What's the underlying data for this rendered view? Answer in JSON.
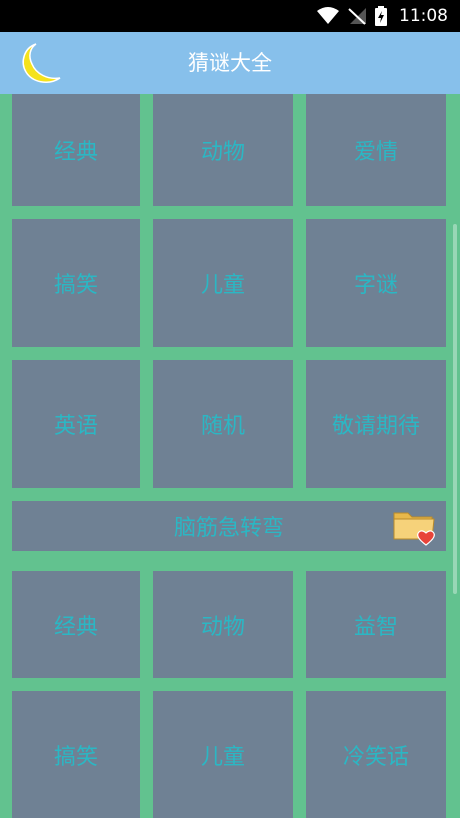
{
  "status_bar": {
    "time": "11:08"
  },
  "app_bar": {
    "title": "猜谜大全"
  },
  "riddle_grid": [
    {
      "label": "经典"
    },
    {
      "label": "动物"
    },
    {
      "label": "爱情"
    },
    {
      "label": "搞笑"
    },
    {
      "label": "儿童"
    },
    {
      "label": "字谜"
    },
    {
      "label": "英语"
    },
    {
      "label": "随机"
    },
    {
      "label": "敬请期待"
    }
  ],
  "brain_teaser": {
    "title": "脑筋急转弯"
  },
  "teaser_grid": [
    {
      "label": "经典"
    },
    {
      "label": "动物"
    },
    {
      "label": "益智"
    },
    {
      "label": "搞笑"
    },
    {
      "label": "儿童"
    },
    {
      "label": "冷笑话"
    }
  ],
  "colors": {
    "tile": "#6f8194",
    "tile_text": "#2bb7c4",
    "background": "#62c28f",
    "app_bar": "#87c0eb"
  },
  "icons": [
    "moon-icon",
    "wifi-icon",
    "signal-icon",
    "battery-icon",
    "favorites-folder-icon"
  ]
}
